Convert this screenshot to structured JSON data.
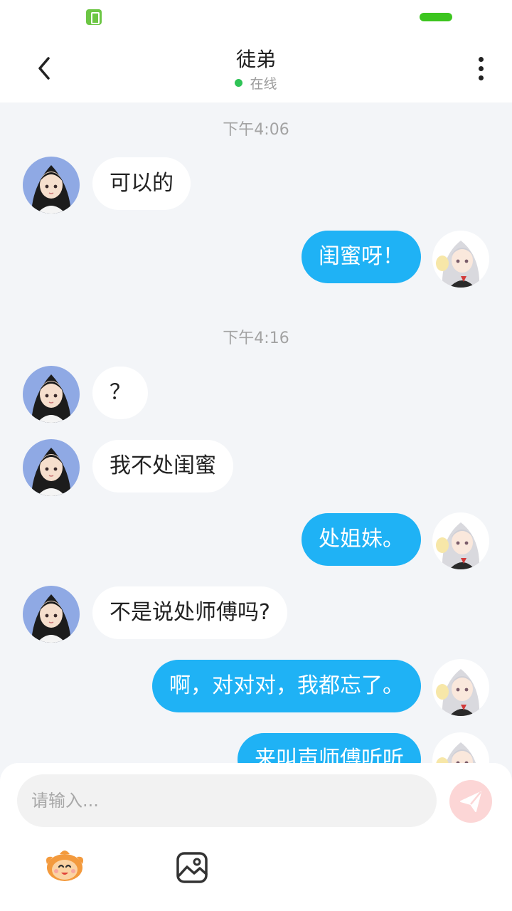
{
  "header": {
    "title": "徒弟",
    "status": "在线"
  },
  "messages": [
    {
      "type": "timestamp",
      "text": "下午4:06"
    },
    {
      "type": "in",
      "text": "可以的"
    },
    {
      "type": "out",
      "text": "闺蜜呀！"
    },
    {
      "type": "timestamp",
      "text": "下午4:16"
    },
    {
      "type": "in",
      "text": "？"
    },
    {
      "type": "in",
      "text": "我不处闺蜜"
    },
    {
      "type": "out",
      "text": "处姐妹。"
    },
    {
      "type": "in",
      "text": "不是说处师傅吗?"
    },
    {
      "type": "out",
      "text": "啊，对对对，我都忘了。"
    },
    {
      "type": "out",
      "text": "来叫声师傅听听"
    }
  ],
  "composer": {
    "placeholder": "请输入..."
  },
  "colors": {
    "outgoing_bubble": "#1fb2f5",
    "incoming_bubble": "#ffffff",
    "online_dot": "#2fc356",
    "send_button": "#fcd6d6"
  }
}
